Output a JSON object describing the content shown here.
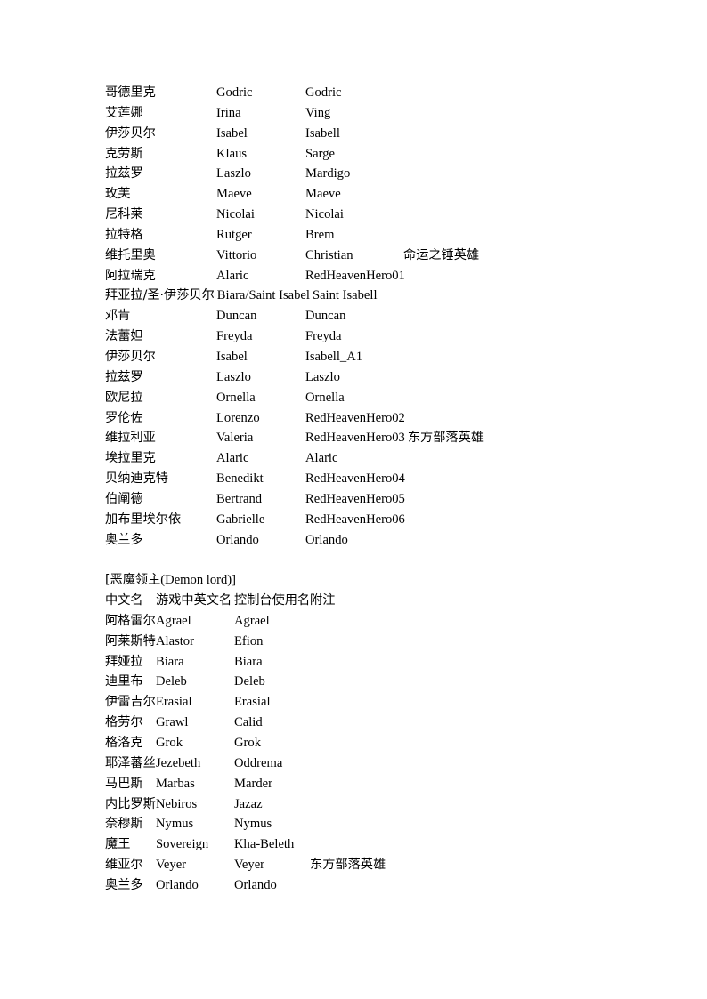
{
  "document": {
    "background_color": "#ffffff",
    "text_color": "#000000",
    "page_size": "794x1123"
  },
  "table1": {
    "columns": [
      "中文名",
      "游戏中英文名",
      "控制台使用名",
      "附注"
    ],
    "rows": [
      {
        "cn": "哥德里克",
        "game": "Godric",
        "console": "Godric",
        "note": ""
      },
      {
        "cn": "艾莲娜",
        "game": "Irina",
        "console": "Ving",
        "note": ""
      },
      {
        "cn": "伊莎贝尔",
        "game": "Isabel",
        "console": "Isabell",
        "note": ""
      },
      {
        "cn": "克劳斯",
        "game": "Klaus",
        "console": "Sarge",
        "note": ""
      },
      {
        "cn": "拉兹罗",
        "game": "Laszlo",
        "console": "Mardigo",
        "note": ""
      },
      {
        "cn": "玫芙",
        "game": "Maeve",
        "console": "Maeve",
        "note": ""
      },
      {
        "cn": "尼科莱",
        "game": "Nicolai",
        "console": "Nicolai",
        "note": ""
      },
      {
        "cn": "拉特格",
        "game": "Rutger",
        "console": "Brem",
        "note": ""
      },
      {
        "cn": "维托里奥",
        "game": "Vittorio",
        "console": "Christian",
        "note": "命运之锤英雄"
      },
      {
        "cn": "阿拉瑞克",
        "game": "Alaric",
        "console": "RedHeavenHero01",
        "note": ""
      },
      {
        "cn": "拜亚拉/圣·伊莎贝尔",
        "game": "Biara/Saint Isabel",
        "console": "Saint Isabell",
        "note": "",
        "overflow": true
      },
      {
        "cn": "邓肯",
        "game": "Duncan",
        "console": "Duncan",
        "note": ""
      },
      {
        "cn": "法蕾妲",
        "game": "Freyda",
        "console": "Freyda",
        "note": ""
      },
      {
        "cn": "伊莎贝尔",
        "game": "Isabel",
        "console": "Isabell_A1",
        "note": ""
      },
      {
        "cn": "拉兹罗",
        "game": "Laszlo",
        "console": "Laszlo",
        "note": ""
      },
      {
        "cn": "欧尼拉",
        "game": "Ornella",
        "console": "Ornella",
        "note": ""
      },
      {
        "cn": "罗伦佐",
        "game": "Lorenzo",
        "console": "RedHeavenHero02",
        "note": ""
      },
      {
        "cn": "维拉利亚",
        "game": "Valeria",
        "console": "RedHeavenHero03",
        "note": "东方部落英雄",
        "note_inline": true
      },
      {
        "cn": "埃拉里克",
        "game": "Alaric",
        "console": "Alaric",
        "note": ""
      },
      {
        "cn": "贝纳迪克特",
        "game": "Benedikt",
        "console": "RedHeavenHero04",
        "note": ""
      },
      {
        "cn": "伯阐德",
        "game": "Bertrand",
        "console": "RedHeavenHero05",
        "note": ""
      },
      {
        "cn": "加布里埃尔依",
        "game": "Gabrielle",
        "console": "RedHeavenHero06",
        "note": ""
      },
      {
        "cn": "奥兰多",
        "game": "Orlando",
        "console": "Orlando",
        "note": ""
      }
    ]
  },
  "table2": {
    "title": "[恶魔领主(Demon lord)]",
    "title_cn": "[恶魔领主",
    "title_en": "(Demon lord)]",
    "columns": [
      "中文名",
      "游戏中英文名",
      "控制台使用名",
      "附注"
    ],
    "rows": [
      {
        "cn": "阿格雷尔",
        "game": "Agrael",
        "console": "Agrael",
        "note": ""
      },
      {
        "cn": "阿莱斯特",
        "game": "Alastor",
        "console": "Efion",
        "note": ""
      },
      {
        "cn": "拜娅拉",
        "game": "Biara",
        "console": "Biara",
        "note": ""
      },
      {
        "cn": "迪里布",
        "game": "Deleb",
        "console": "Deleb",
        "note": ""
      },
      {
        "cn": "伊雷吉尔",
        "game": "Erasial",
        "console": "Erasial",
        "note": ""
      },
      {
        "cn": "格劳尔",
        "game": "Grawl",
        "console": "Calid",
        "note": ""
      },
      {
        "cn": "格洛克",
        "game": "Grok",
        "console": "Grok",
        "note": ""
      },
      {
        "cn": "耶泽蕃丝",
        "game": "Jezebeth",
        "console": "Oddrema",
        "note": ""
      },
      {
        "cn": "马巴斯",
        "game": "Marbas",
        "console": "Marder",
        "note": ""
      },
      {
        "cn": "内比罗斯",
        "game": "Nebiros",
        "console": "Jazaz",
        "note": ""
      },
      {
        "cn": "奈穆斯",
        "game": "Nymus",
        "console": "Nymus",
        "note": ""
      },
      {
        "cn": "魔王",
        "game": "Sovereign",
        "console": "Kha-Beleth",
        "note": ""
      },
      {
        "cn": "维亚尔",
        "game": "Veyer",
        "console": "Veyer",
        "note": "东方部落英雄"
      },
      {
        "cn": "奥兰多",
        "game": "Orlando",
        "console": "Orlando",
        "note": ""
      }
    ]
  }
}
